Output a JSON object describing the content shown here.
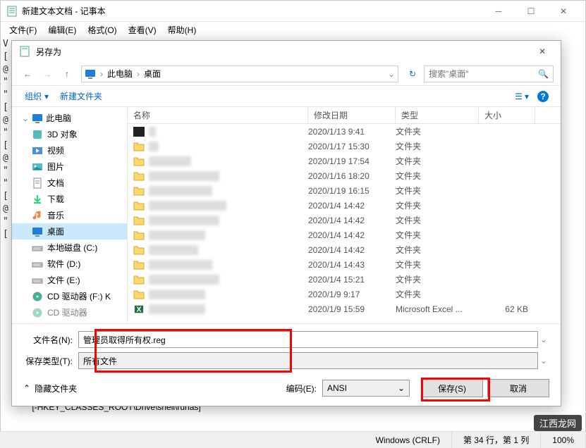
{
  "main_window": {
    "title": "新建文本文档 - 记事本",
    "menus": [
      "文件(F)",
      "编辑(E)",
      "格式(O)",
      "查看(V)",
      "帮助(H)"
    ],
    "content_line": "[-HKEY_CLASSES_ROOT\\Drive\\shell\\runas]",
    "obscured_chars": "V\n[\n@\n\"\n\"\n\n[\n@\n\"\n\n[\n@\n\"\n\"\n\n[\n@\n\"\n\n["
  },
  "statusbar": {
    "line_ending": "Windows (CRLF)",
    "cursor": "第 34 行，第 1 列",
    "zoom": "100%"
  },
  "dialog": {
    "title": "另存为",
    "breadcrumb": [
      "此电脑",
      "桌面"
    ],
    "search_placeholder": "搜索\"桌面\"",
    "toolbar": {
      "organize": "组织",
      "new_folder": "新建文件夹"
    },
    "sidebar": {
      "this_pc": "此电脑",
      "items": [
        {
          "label": "3D 对象",
          "icon": "3d"
        },
        {
          "label": "视频",
          "icon": "video"
        },
        {
          "label": "图片",
          "icon": "pictures"
        },
        {
          "label": "文档",
          "icon": "documents"
        },
        {
          "label": "下载",
          "icon": "downloads"
        },
        {
          "label": "音乐",
          "icon": "music"
        },
        {
          "label": "桌面",
          "icon": "desktop",
          "selected": true
        },
        {
          "label": "本地磁盘 (C:)",
          "icon": "drive"
        },
        {
          "label": "软件 (D:)",
          "icon": "drive"
        },
        {
          "label": "文件 (E:)",
          "icon": "drive"
        },
        {
          "label": "CD 驱动器 (F:) K",
          "icon": "cd"
        },
        {
          "label": "CD 驱动器",
          "icon": "cd"
        }
      ]
    },
    "columns": {
      "name": "名称",
      "date": "修改日期",
      "type": "类型",
      "size": "大小"
    },
    "files": [
      {
        "date": "2020/1/13 9:41",
        "type": "文件夹",
        "size": "",
        "blurred": true
      },
      {
        "date": "2020/1/17 15:30",
        "type": "文件夹",
        "size": "",
        "blurred": true
      },
      {
        "date": "2020/1/19 17:54",
        "type": "文件夹",
        "size": "",
        "blurred": true
      },
      {
        "date": "2020/1/16 18:20",
        "type": "文件夹",
        "size": "",
        "blurred": true
      },
      {
        "date": "2020/1/19 16:15",
        "type": "文件夹",
        "size": "",
        "blurred": true
      },
      {
        "date": "2020/1/4 14:42",
        "type": "文件夹",
        "size": "",
        "blurred": true
      },
      {
        "date": "2020/1/4 14:42",
        "type": "文件夹",
        "size": "",
        "blurred": true
      },
      {
        "date": "2020/1/4 14:42",
        "type": "文件夹",
        "size": "",
        "blurred": true
      },
      {
        "date": "2020/1/4 14:42",
        "type": "文件夹",
        "size": "",
        "blurred": true
      },
      {
        "date": "2020/1/4 14:43",
        "type": "文件夹",
        "size": "",
        "blurred": true
      },
      {
        "date": "2020/1/4 15:21",
        "type": "文件夹",
        "size": "",
        "blurred": true
      },
      {
        "date": "2020/1/9 9:17",
        "type": "文件夹",
        "size": "",
        "blurred": true
      },
      {
        "date": "2020/1/9 15:59",
        "type": "Microsoft Excel ...",
        "size": "62 KB",
        "blurred": true,
        "excel": true
      }
    ],
    "filename_label": "文件名(N):",
    "filename_value": "管理员取得所有权.reg",
    "filetype_label": "保存类型(T):",
    "filetype_value": "所有文件",
    "hide_folders": "隐藏文件夹",
    "encoding_label": "编码(E):",
    "encoding_value": "ANSI",
    "save_button": "保存(S)",
    "cancel_button": "取消"
  },
  "watermark": "江西龙网"
}
